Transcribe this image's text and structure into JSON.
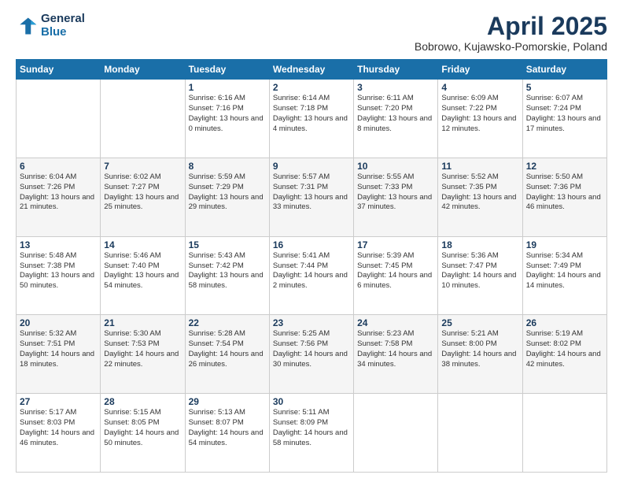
{
  "header": {
    "logo_line1": "General",
    "logo_line2": "Blue",
    "month_year": "April 2025",
    "location": "Bobrowo, Kujawsko-Pomorskie, Poland"
  },
  "weekdays": [
    "Sunday",
    "Monday",
    "Tuesday",
    "Wednesday",
    "Thursday",
    "Friday",
    "Saturday"
  ],
  "weeks": [
    [
      {
        "day": "",
        "sunrise": "",
        "sunset": "",
        "daylight": ""
      },
      {
        "day": "",
        "sunrise": "",
        "sunset": "",
        "daylight": ""
      },
      {
        "day": "1",
        "sunrise": "Sunrise: 6:16 AM",
        "sunset": "Sunset: 7:16 PM",
        "daylight": "Daylight: 13 hours and 0 minutes."
      },
      {
        "day": "2",
        "sunrise": "Sunrise: 6:14 AM",
        "sunset": "Sunset: 7:18 PM",
        "daylight": "Daylight: 13 hours and 4 minutes."
      },
      {
        "day": "3",
        "sunrise": "Sunrise: 6:11 AM",
        "sunset": "Sunset: 7:20 PM",
        "daylight": "Daylight: 13 hours and 8 minutes."
      },
      {
        "day": "4",
        "sunrise": "Sunrise: 6:09 AM",
        "sunset": "Sunset: 7:22 PM",
        "daylight": "Daylight: 13 hours and 12 minutes."
      },
      {
        "day": "5",
        "sunrise": "Sunrise: 6:07 AM",
        "sunset": "Sunset: 7:24 PM",
        "daylight": "Daylight: 13 hours and 17 minutes."
      }
    ],
    [
      {
        "day": "6",
        "sunrise": "Sunrise: 6:04 AM",
        "sunset": "Sunset: 7:26 PM",
        "daylight": "Daylight: 13 hours and 21 minutes."
      },
      {
        "day": "7",
        "sunrise": "Sunrise: 6:02 AM",
        "sunset": "Sunset: 7:27 PM",
        "daylight": "Daylight: 13 hours and 25 minutes."
      },
      {
        "day": "8",
        "sunrise": "Sunrise: 5:59 AM",
        "sunset": "Sunset: 7:29 PM",
        "daylight": "Daylight: 13 hours and 29 minutes."
      },
      {
        "day": "9",
        "sunrise": "Sunrise: 5:57 AM",
        "sunset": "Sunset: 7:31 PM",
        "daylight": "Daylight: 13 hours and 33 minutes."
      },
      {
        "day": "10",
        "sunrise": "Sunrise: 5:55 AM",
        "sunset": "Sunset: 7:33 PM",
        "daylight": "Daylight: 13 hours and 37 minutes."
      },
      {
        "day": "11",
        "sunrise": "Sunrise: 5:52 AM",
        "sunset": "Sunset: 7:35 PM",
        "daylight": "Daylight: 13 hours and 42 minutes."
      },
      {
        "day": "12",
        "sunrise": "Sunrise: 5:50 AM",
        "sunset": "Sunset: 7:36 PM",
        "daylight": "Daylight: 13 hours and 46 minutes."
      }
    ],
    [
      {
        "day": "13",
        "sunrise": "Sunrise: 5:48 AM",
        "sunset": "Sunset: 7:38 PM",
        "daylight": "Daylight: 13 hours and 50 minutes."
      },
      {
        "day": "14",
        "sunrise": "Sunrise: 5:46 AM",
        "sunset": "Sunset: 7:40 PM",
        "daylight": "Daylight: 13 hours and 54 minutes."
      },
      {
        "day": "15",
        "sunrise": "Sunrise: 5:43 AM",
        "sunset": "Sunset: 7:42 PM",
        "daylight": "Daylight: 13 hours and 58 minutes."
      },
      {
        "day": "16",
        "sunrise": "Sunrise: 5:41 AM",
        "sunset": "Sunset: 7:44 PM",
        "daylight": "Daylight: 14 hours and 2 minutes."
      },
      {
        "day": "17",
        "sunrise": "Sunrise: 5:39 AM",
        "sunset": "Sunset: 7:45 PM",
        "daylight": "Daylight: 14 hours and 6 minutes."
      },
      {
        "day": "18",
        "sunrise": "Sunrise: 5:36 AM",
        "sunset": "Sunset: 7:47 PM",
        "daylight": "Daylight: 14 hours and 10 minutes."
      },
      {
        "day": "19",
        "sunrise": "Sunrise: 5:34 AM",
        "sunset": "Sunset: 7:49 PM",
        "daylight": "Daylight: 14 hours and 14 minutes."
      }
    ],
    [
      {
        "day": "20",
        "sunrise": "Sunrise: 5:32 AM",
        "sunset": "Sunset: 7:51 PM",
        "daylight": "Daylight: 14 hours and 18 minutes."
      },
      {
        "day": "21",
        "sunrise": "Sunrise: 5:30 AM",
        "sunset": "Sunset: 7:53 PM",
        "daylight": "Daylight: 14 hours and 22 minutes."
      },
      {
        "day": "22",
        "sunrise": "Sunrise: 5:28 AM",
        "sunset": "Sunset: 7:54 PM",
        "daylight": "Daylight: 14 hours and 26 minutes."
      },
      {
        "day": "23",
        "sunrise": "Sunrise: 5:25 AM",
        "sunset": "Sunset: 7:56 PM",
        "daylight": "Daylight: 14 hours and 30 minutes."
      },
      {
        "day": "24",
        "sunrise": "Sunrise: 5:23 AM",
        "sunset": "Sunset: 7:58 PM",
        "daylight": "Daylight: 14 hours and 34 minutes."
      },
      {
        "day": "25",
        "sunrise": "Sunrise: 5:21 AM",
        "sunset": "Sunset: 8:00 PM",
        "daylight": "Daylight: 14 hours and 38 minutes."
      },
      {
        "day": "26",
        "sunrise": "Sunrise: 5:19 AM",
        "sunset": "Sunset: 8:02 PM",
        "daylight": "Daylight: 14 hours and 42 minutes."
      }
    ],
    [
      {
        "day": "27",
        "sunrise": "Sunrise: 5:17 AM",
        "sunset": "Sunset: 8:03 PM",
        "daylight": "Daylight: 14 hours and 46 minutes."
      },
      {
        "day": "28",
        "sunrise": "Sunrise: 5:15 AM",
        "sunset": "Sunset: 8:05 PM",
        "daylight": "Daylight: 14 hours and 50 minutes."
      },
      {
        "day": "29",
        "sunrise": "Sunrise: 5:13 AM",
        "sunset": "Sunset: 8:07 PM",
        "daylight": "Daylight: 14 hours and 54 minutes."
      },
      {
        "day": "30",
        "sunrise": "Sunrise: 5:11 AM",
        "sunset": "Sunset: 8:09 PM",
        "daylight": "Daylight: 14 hours and 58 minutes."
      },
      {
        "day": "",
        "sunrise": "",
        "sunset": "",
        "daylight": ""
      },
      {
        "day": "",
        "sunrise": "",
        "sunset": "",
        "daylight": ""
      },
      {
        "day": "",
        "sunrise": "",
        "sunset": "",
        "daylight": ""
      }
    ]
  ]
}
